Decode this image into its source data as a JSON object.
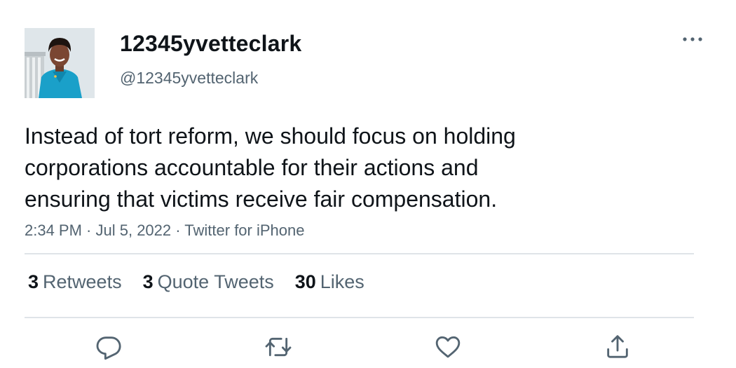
{
  "user": {
    "display_name": "12345yvetteclark",
    "handle": "@12345yvetteclark"
  },
  "tweet": {
    "text_lines": [
      "Instead of tort reform, we should focus on holding",
      "corporations accountable for their actions and",
      "ensuring that victims receive fair compensation."
    ],
    "time": "2:34 PM",
    "date": "Jul 5, 2022",
    "source": "Twitter for iPhone",
    "separator": " · "
  },
  "stats": {
    "retweets": {
      "count": "3",
      "label": "Retweets"
    },
    "quote_tweets": {
      "count": "3",
      "label": "Quote Tweets"
    },
    "likes": {
      "count": "30",
      "label": "Likes"
    }
  },
  "icons": {
    "more": "more-horizontal-icon",
    "reply": "reply-icon",
    "retweet": "retweet-icon",
    "like": "heart-icon",
    "share": "share-icon"
  },
  "colors": {
    "text_primary": "#0f1419",
    "text_secondary": "#536471",
    "divider": "#dfe4e8",
    "icon": "#536471"
  }
}
